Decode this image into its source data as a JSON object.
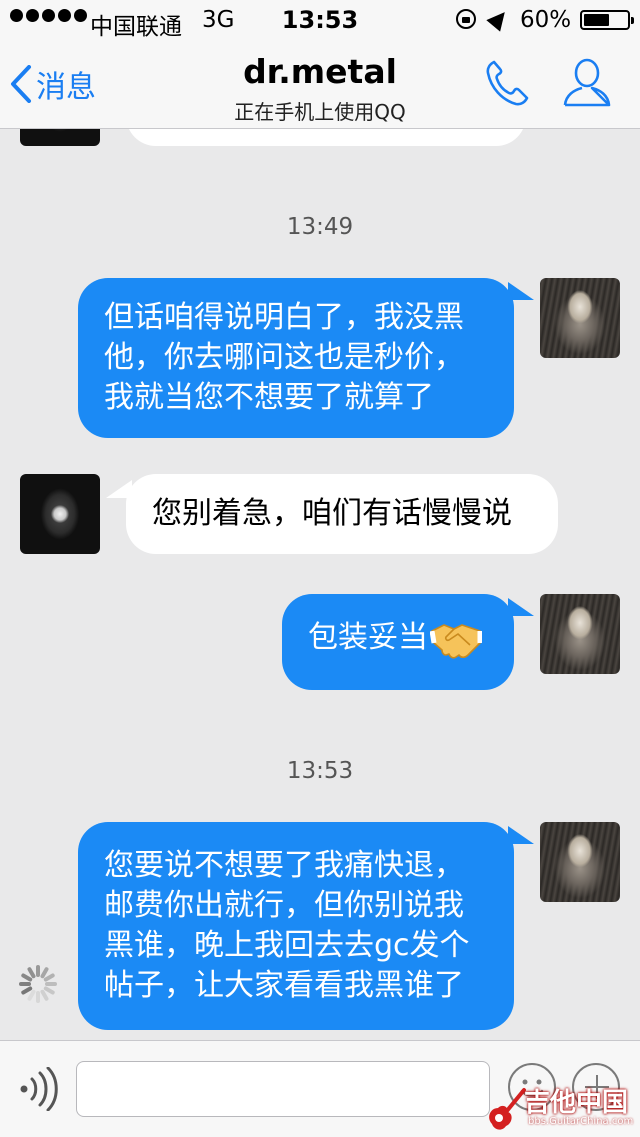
{
  "status_bar": {
    "carrier": "中国联通",
    "network": "3G",
    "time": "13:53",
    "battery_percent": "60%",
    "battery_level": 0.6
  },
  "nav": {
    "back_label": "消息",
    "title": "dr.metal",
    "subtitle": "正在手机上使用QQ"
  },
  "messages": {
    "time_1": "13:49",
    "msg_1": "但话咱得说明白了，我没黑他，你去哪问这也是秒价，我就当您不想要了就算了",
    "msg_2": "您别着急，咱们有话慢慢说",
    "msg_3": "包装妥当",
    "time_2": "13:53",
    "msg_4": "您要说不想要了我痛快退，邮费你出就行，但你别说我黑谁，晚上我回去去gc发个帖子，让大家看看我黑谁了"
  },
  "input": {
    "placeholder": ""
  },
  "watermark": {
    "text": "吉他中国",
    "url": "bbs.GuitarChina.com"
  },
  "colors": {
    "accent": "#1a7ef2",
    "outgoing_bubble": "#1b8af5",
    "incoming_bubble": "#ffffff",
    "background": "#e9e9ea"
  }
}
